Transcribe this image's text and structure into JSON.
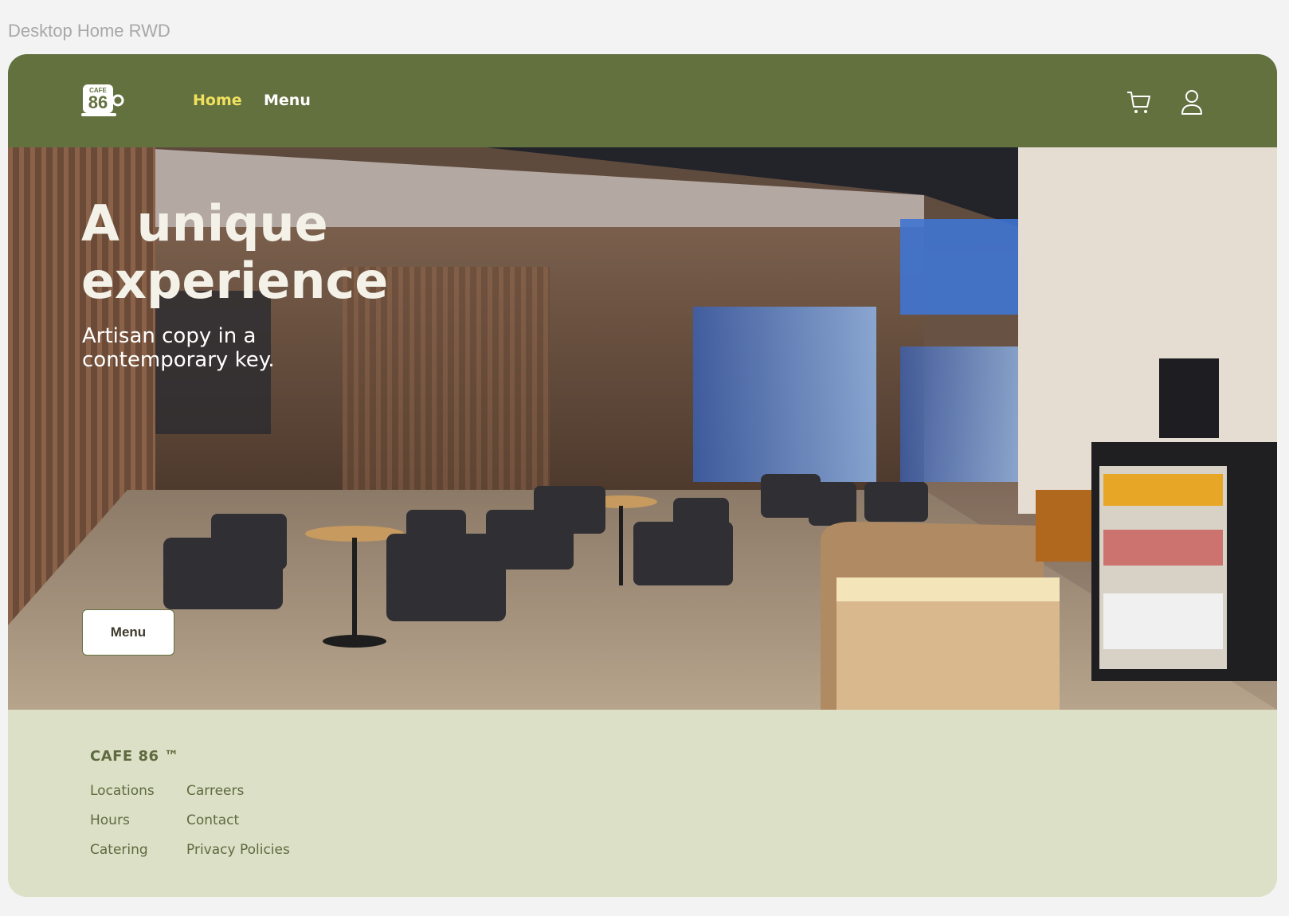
{
  "frame_label": "Desktop Home RWD",
  "header": {
    "logo_text_top": "CAFE",
    "logo_text_num": "86",
    "nav": {
      "home": "Home",
      "menu": "Menu"
    },
    "icons": [
      "cart-icon",
      "user-icon"
    ]
  },
  "hero": {
    "title": "A unique experience",
    "subtitle": "Artisan copy in a contemporary key.",
    "button": "Menu"
  },
  "footer": {
    "brand": "CAFE 86 ™",
    "links_col1": [
      "Locations",
      "Hours",
      "Catering"
    ],
    "links_col2": [
      "Carreers",
      "Contact",
      "Privacy Policies"
    ]
  },
  "colors": {
    "header_bg": "#63713f",
    "nav_active": "#f2e15f",
    "footer_bg": "#dbe0c6",
    "footer_text": "#5f6a40"
  }
}
